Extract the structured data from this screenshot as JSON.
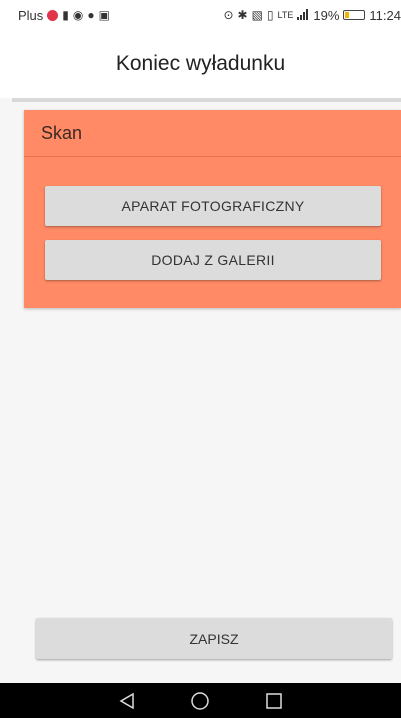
{
  "status_bar": {
    "carrier": "Plus",
    "signal_label": "LTE",
    "battery_percent": "19%",
    "battery_level": 0.19,
    "time": "11:24",
    "left_icons": [
      "vivaldi-icon",
      "sim-icon",
      "chrome-icon",
      "chat-icon",
      "mail-icon"
    ],
    "right_icons": [
      "location-icon",
      "bluetooth-icon",
      "nfc-icon",
      "vibrate-icon",
      "signal-icon",
      "battery-icon"
    ]
  },
  "header": {
    "title": "Koniec wyładunku"
  },
  "scan_card": {
    "title": "Skan",
    "camera_button": "APARAT FOTOGRAFICZNY",
    "gallery_button": "DODAJ Z GALERII",
    "accent_color": "#ff8a65"
  },
  "footer": {
    "save_button": "ZAPISZ"
  },
  "nav_bar": {
    "buttons": [
      "back-icon",
      "home-icon",
      "recents-icon"
    ]
  }
}
